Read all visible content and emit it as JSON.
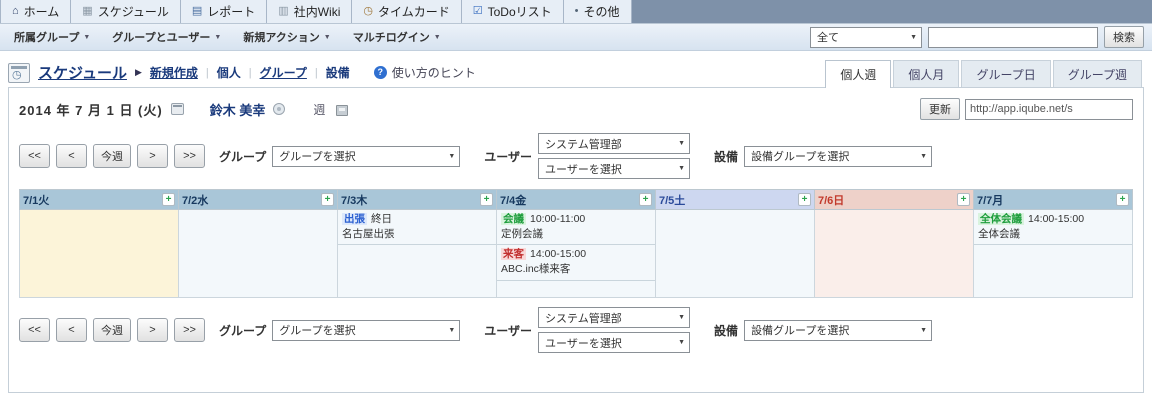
{
  "app": {
    "tabs": [
      {
        "label": "ホーム",
        "icon": "home-icon",
        "glyph": "⌂",
        "color": "#2c3e66"
      },
      {
        "label": "スケジュール",
        "icon": "calendar-icon",
        "glyph": "▦",
        "color": "#8a97a4"
      },
      {
        "label": "レポート",
        "icon": "report-icon",
        "glyph": "▤",
        "color": "#4a6fa0"
      },
      {
        "label": "社内Wiki",
        "icon": "wiki-icon",
        "glyph": "▥",
        "color": "#8a97a4"
      },
      {
        "label": "タイムカード",
        "icon": "clock-icon",
        "glyph": "◷",
        "color": "#a0783c"
      },
      {
        "label": "ToDoリスト",
        "icon": "todo-icon",
        "glyph": "☑",
        "color": "#3a6fc0"
      },
      {
        "label": "その他",
        "icon": "dot-icon",
        "glyph": "•",
        "color": "#556677"
      }
    ],
    "menu": [
      "所属グループ",
      "グループとユーザー",
      "新規アクション",
      "マルチログイン"
    ],
    "search": {
      "filter": "全て",
      "query": "",
      "button": "検索"
    }
  },
  "header": {
    "title": "スケジュール",
    "arrow": "▶",
    "links": [
      {
        "label": "新規作成",
        "underline": true
      },
      {
        "label": "個人",
        "underline": false
      },
      {
        "label": "グループ",
        "underline": true
      },
      {
        "label": "設備",
        "underline": false
      }
    ],
    "help": "使い方のヒント",
    "view_tabs": [
      "個人週",
      "個人月",
      "グループ日",
      "グループ週"
    ],
    "active_view": 0
  },
  "toolbar": {
    "date": "2014 年 7 月 1 日 (火)",
    "user": "鈴木 美幸",
    "week": "週",
    "refresh": "更新",
    "url": "http://app.iqube.net/s"
  },
  "nav": {
    "buttons": [
      "<<",
      "<",
      "今週",
      ">",
      ">>"
    ],
    "group_label": "グループ",
    "group_value": "グループを選択",
    "user_label": "ユーザー",
    "user_value_1": "システム管理部",
    "user_value_2": "ユーザーを選択",
    "equip_label": "設備",
    "equip_value": "設備グループを選択"
  },
  "calendar": {
    "days": [
      {
        "label": "7/1火",
        "header": "weekday",
        "body": "today",
        "events": []
      },
      {
        "label": "7/2水",
        "header": "weekday",
        "body": "weekday",
        "events": []
      },
      {
        "label": "7/3木",
        "header": "weekday",
        "body": "weekday",
        "events": [
          {
            "tag": "出張",
            "tag_color": "blue",
            "time": "終日",
            "title": "名古屋出張"
          }
        ]
      },
      {
        "label": "7/4金",
        "header": "weekday",
        "body": "weekday",
        "events": [
          {
            "tag": "会議",
            "tag_color": "green",
            "time": "10:00-11:00",
            "title": "定例会議"
          },
          {
            "tag": "来客",
            "tag_color": "red",
            "time": "14:00-15:00",
            "title": "ABC.inc様来客"
          }
        ]
      },
      {
        "label": "7/5土",
        "header": "saturday",
        "body": "weekday",
        "events": []
      },
      {
        "label": "7/6日",
        "header": "sunday",
        "body": "sunday",
        "events": []
      },
      {
        "label": "7/7月",
        "header": "weekday",
        "body": "weekday",
        "events": [
          {
            "tag": "全体会議",
            "tag_color": "green",
            "time": "14:00-15:00",
            "title": "全体会議"
          }
        ]
      }
    ]
  },
  "status_colors": {
    "trip_blue": "#2a5fd0",
    "meeting_green": "#1f9e3e",
    "visitor_red": "#c23030",
    "today_bg": "#fcf4d9",
    "sunday_bg": "#faeeea",
    "weekday_header": "#a9c6d8",
    "saturday_header": "#cdd7f0",
    "sunday_header": "#eed1c9"
  }
}
